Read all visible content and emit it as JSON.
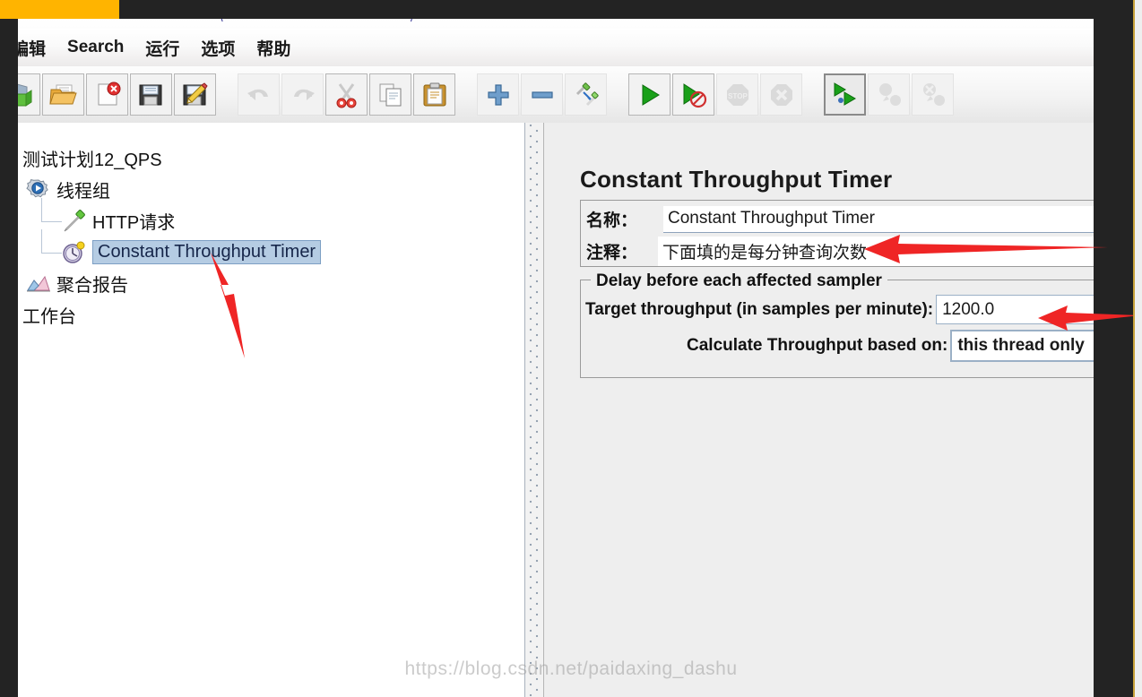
{
  "window": {
    "title_fragments": [
      "\\",
      "/"
    ]
  },
  "menubar": {
    "items": [
      {
        "label": "编辑",
        "name": "menu-edit"
      },
      {
        "label": "Search",
        "name": "menu-search"
      },
      {
        "label": "运行",
        "name": "menu-run"
      },
      {
        "label": "选项",
        "name": "menu-options"
      },
      {
        "label": "帮助",
        "name": "menu-help"
      }
    ]
  },
  "toolbar": {
    "buttons": [
      {
        "icon": "new-test-plan-icon",
        "name": "toolbar-new",
        "state": "enabled"
      },
      {
        "icon": "open-folder-icon",
        "name": "toolbar-open",
        "state": "enabled"
      },
      {
        "icon": "close-document-icon",
        "name": "toolbar-close",
        "state": "enabled"
      },
      {
        "icon": "save-icon",
        "name": "toolbar-save",
        "state": "enabled"
      },
      {
        "icon": "save-as-icon",
        "name": "toolbar-save-as",
        "state": "enabled"
      },
      {
        "icon": "undo-icon",
        "name": "toolbar-undo",
        "state": "disabled"
      },
      {
        "icon": "redo-icon",
        "name": "toolbar-redo",
        "state": "disabled"
      },
      {
        "icon": "cut-scissors-icon",
        "name": "toolbar-cut",
        "state": "enabled"
      },
      {
        "icon": "copy-icon",
        "name": "toolbar-copy",
        "state": "enabled"
      },
      {
        "icon": "paste-clipboard-icon",
        "name": "toolbar-paste",
        "state": "enabled"
      },
      {
        "icon": "expand-plus-icon",
        "name": "toolbar-expand-all",
        "state": "enabled"
      },
      {
        "icon": "collapse-minus-icon",
        "name": "toolbar-collapse-all",
        "state": "enabled"
      },
      {
        "icon": "toggle-element-icon",
        "name": "toolbar-toggle",
        "state": "enabled"
      },
      {
        "icon": "start-play-icon",
        "name": "toolbar-start",
        "state": "enabled"
      },
      {
        "icon": "start-no-pauses-icon",
        "name": "toolbar-start-no-pauses",
        "state": "enabled"
      },
      {
        "icon": "stop-icon",
        "name": "toolbar-stop",
        "state": "disabled"
      },
      {
        "icon": "shutdown-icon",
        "name": "toolbar-shutdown",
        "state": "disabled"
      },
      {
        "icon": "remote-start-all-icon",
        "name": "toolbar-remote-start-all",
        "state": "selected"
      },
      {
        "icon": "remote-stop-all-icon",
        "name": "toolbar-remote-stop-all",
        "state": "disabled"
      },
      {
        "icon": "remote-shutdown-all-icon",
        "name": "toolbar-remote-shutdown-all",
        "state": "disabled"
      }
    ]
  },
  "tree": {
    "nodes": [
      {
        "label": "测试计划12_QPS",
        "icon": "test-plan-icon",
        "indent": 0,
        "selected": false,
        "name": "tree-node-test-plan"
      },
      {
        "label": "线程组",
        "icon": "thread-group-icon",
        "indent": 1,
        "selected": false,
        "name": "tree-node-thread-group"
      },
      {
        "label": "HTTP请求",
        "icon": "http-request-icon",
        "indent": 2,
        "selected": false,
        "name": "tree-node-http-request"
      },
      {
        "label": "Constant Throughput Timer",
        "icon": "timer-clock-icon",
        "indent": 2,
        "selected": true,
        "name": "tree-node-constant-throughput-timer"
      },
      {
        "label": "聚合报告",
        "icon": "aggregate-report-icon",
        "indent": 1,
        "selected": false,
        "name": "tree-node-aggregate-report"
      },
      {
        "label": "工作台",
        "icon": "workbench-icon",
        "indent": 0,
        "selected": false,
        "name": "tree-node-workbench"
      }
    ]
  },
  "panel": {
    "title": "Constant Throughput Timer",
    "name_label": "名称：",
    "name_value": "Constant Throughput Timer",
    "comment_label": "注释：",
    "comment_value": "下面填的是每分钟查询次数",
    "group_legend": "Delay before each affected sampler",
    "target_label": "Target throughput (in samples per minute):",
    "target_value": "1200.0",
    "calculate_label": "Calculate Throughput based on:",
    "calculate_value": "this thread only"
  },
  "annotations": {
    "arrows": [
      {
        "name": "arrow-pointing-selected-tree-node",
        "target": "Constant Throughput Timer tree node"
      },
      {
        "name": "arrow-pointing-comment-field",
        "target": "注释 comment field"
      },
      {
        "name": "arrow-pointing-target-throughput",
        "target": "Target throughput value"
      }
    ]
  },
  "watermark": {
    "text": "https://blog.csdn.net/paidaxing_dashu"
  },
  "colors": {
    "selection_blue": "#b5cce3",
    "arrow_red": "#ef2525",
    "accent_orange": "#ffb400",
    "crop_dark": "#232323"
  }
}
